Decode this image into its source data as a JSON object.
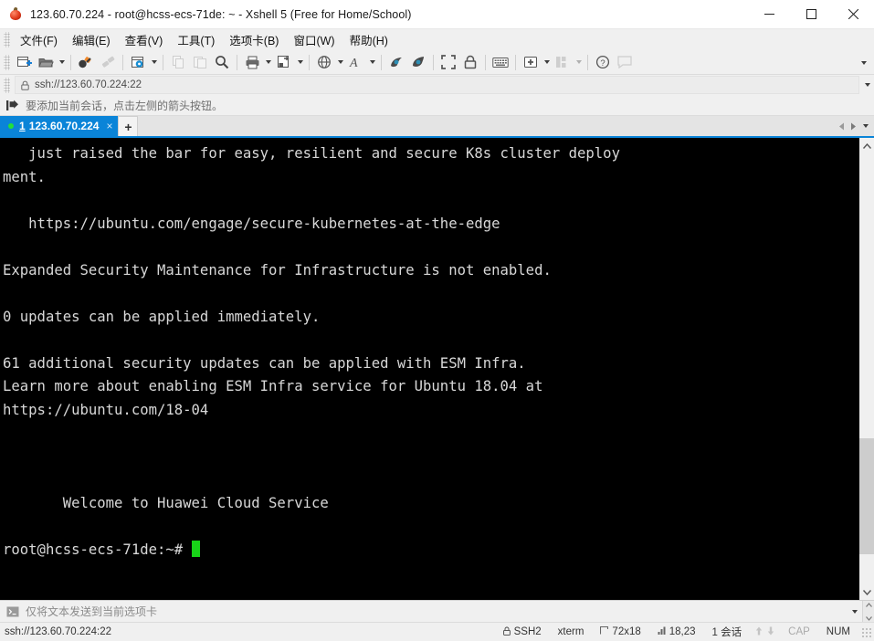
{
  "window": {
    "title": "123.60.70.224 - root@hcss-ecs-71de: ~ - Xshell 5 (Free for Home/School)",
    "app_icon": "xshell-logo-icon",
    "controls": {
      "minimize": "minimize-icon",
      "maximize": "maximize-icon",
      "close": "close-icon"
    }
  },
  "menubar": {
    "items": [
      {
        "label": "文件(F)",
        "name": "menu-file"
      },
      {
        "label": "编辑(E)",
        "name": "menu-edit"
      },
      {
        "label": "查看(V)",
        "name": "menu-view"
      },
      {
        "label": "工具(T)",
        "name": "menu-tools"
      },
      {
        "label": "选项卡(B)",
        "name": "menu-tab"
      },
      {
        "label": "窗口(W)",
        "name": "menu-window"
      },
      {
        "label": "帮助(H)",
        "name": "menu-help"
      }
    ]
  },
  "toolbar": {
    "buttons": [
      {
        "name": "new-session-icon",
        "caret": false,
        "disabled": false
      },
      {
        "name": "open-folder-icon",
        "caret": true,
        "disabled": false
      },
      {
        "name": "connect-icon",
        "caret": false,
        "disabled": false
      },
      {
        "name": "disconnect-icon",
        "caret": false,
        "disabled": true
      },
      {
        "name": "session-properties-icon",
        "caret": true,
        "disabled": false
      },
      {
        "name": "copy-icon",
        "caret": false,
        "disabled": true
      },
      {
        "name": "paste-icon",
        "caret": false,
        "disabled": true
      },
      {
        "name": "find-icon",
        "caret": false,
        "disabled": false
      },
      {
        "name": "print-icon",
        "caret": true,
        "disabled": false
      },
      {
        "name": "file-transfer-icon",
        "caret": true,
        "disabled": false
      },
      {
        "name": "globe-icon",
        "caret": true,
        "disabled": false
      },
      {
        "name": "font-icon",
        "caret": true,
        "disabled": false
      },
      {
        "name": "start-log-icon",
        "caret": false,
        "disabled": false
      },
      {
        "name": "stop-log-icon",
        "caret": false,
        "disabled": false
      },
      {
        "name": "fullscreen-icon",
        "caret": false,
        "disabled": false
      },
      {
        "name": "lock-icon",
        "caret": false,
        "disabled": false
      },
      {
        "name": "keyboard-icon",
        "caret": false,
        "disabled": false
      },
      {
        "name": "add-pane-icon",
        "caret": true,
        "disabled": false
      },
      {
        "name": "arrange-panes-icon",
        "caret": true,
        "disabled": true
      },
      {
        "name": "help-icon",
        "caret": false,
        "disabled": false
      },
      {
        "name": "feedback-icon",
        "caret": false,
        "disabled": true
      }
    ],
    "overflow_label": "toolbar-overflow-icon"
  },
  "address": {
    "icon": "lock-icon",
    "value": "ssh://123.60.70.224:22",
    "placeholder": "ssh://host:port",
    "dropdown": "chevron-down-icon"
  },
  "hint": {
    "icon": "add-session-icon",
    "text": "要添加当前会话，点击左侧的箭头按钮。"
  },
  "tabs": {
    "items": [
      {
        "status_dot": "connected-dot-icon",
        "index": "1",
        "label": "123.60.70.224",
        "close": "×",
        "active": true
      }
    ],
    "new_tab_label": "+",
    "nav_prev": "chevron-left-icon",
    "nav_next": "chevron-right-icon",
    "nav_menu": "chevron-down-icon"
  },
  "terminal": {
    "lines": [
      "   just raised the bar for easy, resilient and secure K8s cluster deploy",
      "ment.",
      "",
      "   https://ubuntu.com/engage/secure-kubernetes-at-the-edge",
      "",
      "Expanded Security Maintenance for Infrastructure is not enabled.",
      "",
      "0 updates can be applied immediately.",
      "",
      "61 additional security updates can be applied with ESM Infra.",
      "Learn more about enabling ESM Infra service for Ubuntu 18.04 at",
      "https://ubuntu.com/18-04",
      "",
      "",
      "",
      "       Welcome to Huawei Cloud Service",
      ""
    ],
    "prompt": "root@hcss-ecs-71de:~# ",
    "cursor_color": "#18d418",
    "fg_color": "#d8d8d8",
    "bg_color": "#000000",
    "scrollbar": {
      "up_arrow": "chevron-up-icon",
      "down_arrow": "chevron-down-icon"
    }
  },
  "sendbar": {
    "icon": "terminal-prompt-icon",
    "text": "仅将文本发送到当前选项卡",
    "value": "",
    "placeholder": "仅将文本发送到当前选项卡",
    "dropdown": "chevron-down-icon"
  },
  "statusbar": {
    "connection": "ssh://123.60.70.224:22",
    "protocol_icon": "lock-icon",
    "protocol": "SSH2",
    "terminal_type": "xterm",
    "size_icon": "screen-size-icon",
    "size": "72x18",
    "cursor_icon": "cursor-position-icon",
    "cursor": "18,23",
    "sessions": "1 会话",
    "up_arrow": "arrow-up-icon",
    "down_arrow": "arrow-down-icon",
    "cap": "CAP",
    "num": "NUM",
    "resize_grip": "resize-grip-icon"
  },
  "colors": {
    "accent": "#0a84d8",
    "chrome": "#f0f0f0",
    "terminal_bg": "#000000",
    "status_dot": "#22e03a"
  }
}
